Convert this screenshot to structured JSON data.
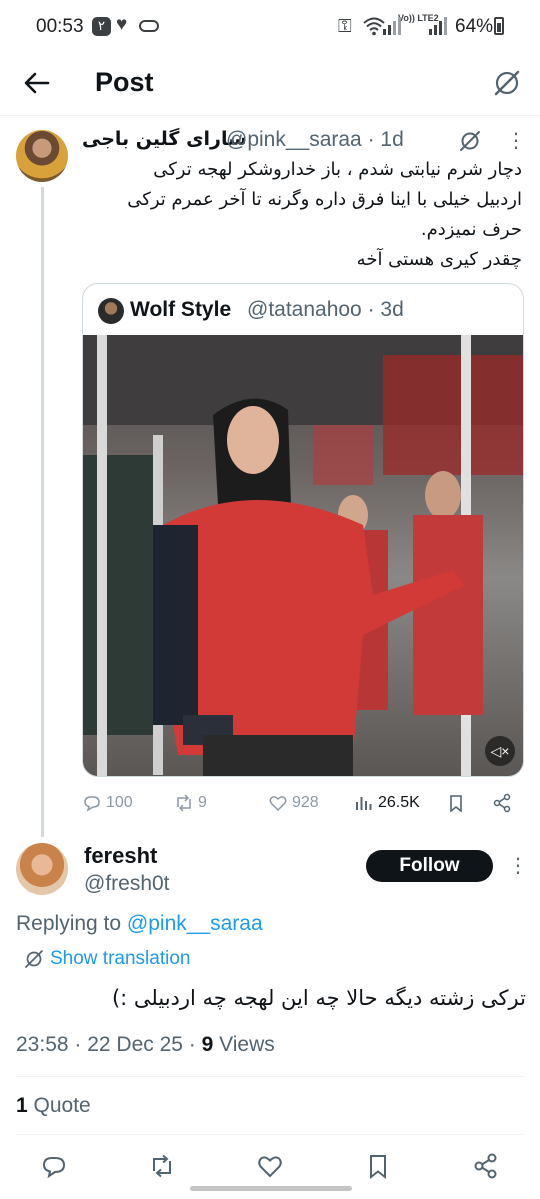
{
  "status_bar": {
    "time": "00:53",
    "badge": "۲",
    "lte": "Vo)) LTE2",
    "battery": "64%"
  },
  "header": {
    "title": "Post"
  },
  "parent_tweet": {
    "name": "سارای گلین باجی",
    "handle_time": "@pink__saraa · 1d",
    "text_lines": [
      "دچار شرم نیابتی شدم ، باز خداروشکر لهجه ترکی",
      "اردبیل خیلی با اینا فرق داره وگرنه تا آخر عمرم ترکی",
      "حرف نمیزدم.",
      "چقدر کیری هستی آخه"
    ],
    "quote": {
      "name": "Wolf Style",
      "handle_time": "@tatanahoo · 3d"
    },
    "stats": {
      "replies": "100",
      "reposts": "9",
      "likes": "928",
      "views": "26.5K"
    }
  },
  "main_tweet": {
    "name": "feresht",
    "handle": "@fresh0t",
    "follow_label": "Follow",
    "replying_prefix": "Replying to ",
    "replying_to": "@pink__saraa",
    "show_translation": "Show translation",
    "text": "ترکی زشته دیگه حالا چه این لهجه چه اردبیلی :)",
    "date": "23:58 · 22 Dec 25 · ",
    "views_count": "9",
    "views_label": " Views",
    "quote_count": "1",
    "quote_label": " Quote"
  },
  "colors": {
    "text": "#0f1419",
    "secondary": "#536471",
    "accent": "#1d9bf0",
    "border": "#cfd9de"
  }
}
